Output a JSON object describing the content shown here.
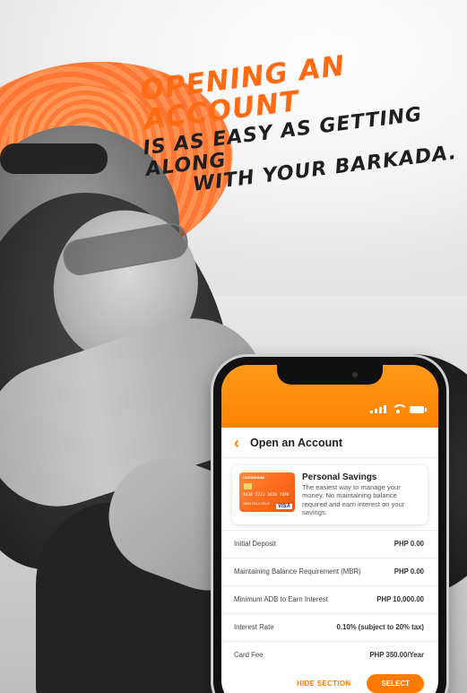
{
  "headline": {
    "line1": "Opening an account",
    "line2": "is as easy as getting along",
    "line3": "with your barkada."
  },
  "phone": {
    "status_bar": {
      "signal_icon": "signal-icon",
      "wifi_icon": "wifi-icon",
      "battery_icon": "battery-icon"
    },
    "nav": {
      "back_icon": "‹",
      "title": "Open an Account"
    },
    "product": {
      "name": "Personal Savings",
      "description": "The easiest way to manage your money. No maintaining balance required and earn interest on your savings.",
      "card": {
        "bank": "UNIONBANK",
        "number": "4434 5213 3456 7890",
        "holder": "JUAN DELA CRUZ",
        "brand": "VISA"
      }
    },
    "details": [
      {
        "label": "Initial Deposit",
        "value": "PHP 0.00"
      },
      {
        "label": "Maintaining Balance Requirement (MBR)",
        "value": "PHP 0.00"
      },
      {
        "label": "Minimum ADB to Earn Interest",
        "value": "PHP 10,000.00"
      },
      {
        "label": "Interest Rate",
        "value": "0.10% (subject to 20% tax)"
      },
      {
        "label": "Card Fee",
        "value": "PHP 350.00/Year"
      }
    ],
    "actions": {
      "hide_label": "HIDE SECTION",
      "select_label": "SELECT"
    }
  },
  "colors": {
    "accent": "#ff7a00",
    "headline_orange": "#ff6a13",
    "headline_dark": "#1f1f1f"
  }
}
